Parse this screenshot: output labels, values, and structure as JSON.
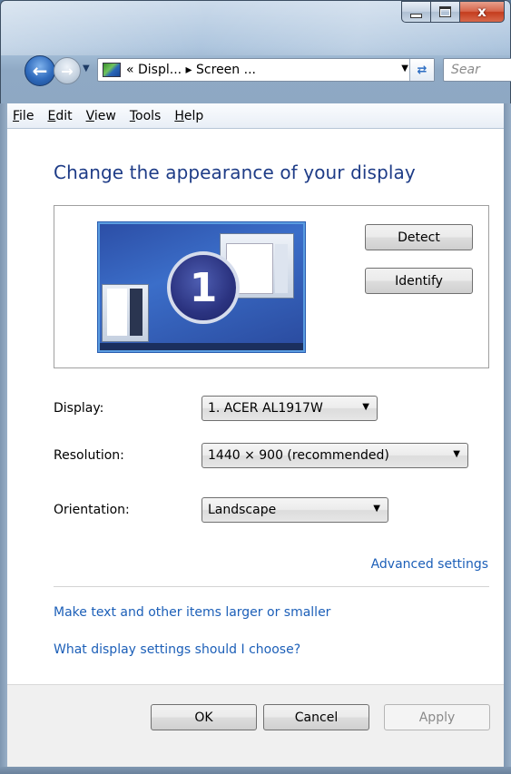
{
  "window": {
    "minimize_icon": "minimize-icon",
    "maximize_icon": "maximize-icon",
    "close_icon": "close-icon",
    "close_glyph": "x"
  },
  "nav": {
    "back_icon": "back-arrow-icon",
    "forward_icon": "forward-arrow-icon",
    "address_text": "« Displ... ▸ Screen ...",
    "search_placeholder": "Sear"
  },
  "menu": {
    "items": [
      {
        "label_first": "F",
        "label_rest": "ile"
      },
      {
        "label_first": "E",
        "label_rest": "dit"
      },
      {
        "label_first": "V",
        "label_rest": "iew"
      },
      {
        "label_first": "T",
        "label_rest": "ools"
      },
      {
        "label_first": "H",
        "label_rest": "elp"
      }
    ]
  },
  "page": {
    "title": "Change the appearance of your display",
    "monitor_number": "1",
    "detect_button": "Detect",
    "identify_button": "Identify"
  },
  "settings": {
    "display_label": "Display:",
    "display_value": "1. ACER AL1917W",
    "resolution_label": "Resolution:",
    "resolution_value": "1440 × 900 (recommended)",
    "orientation_label": "Orientation:",
    "orientation_value": "Landscape"
  },
  "links": {
    "advanced": "Advanced settings",
    "text_size": "Make text and other items larger or smaller",
    "help": "What display settings should I choose?"
  },
  "buttons": {
    "ok": "OK",
    "cancel": "Cancel",
    "apply": "Apply"
  },
  "colors": {
    "title_blue": "#1e3c87",
    "link_blue": "#1c5fb8",
    "close_red": "#c43c1d"
  }
}
